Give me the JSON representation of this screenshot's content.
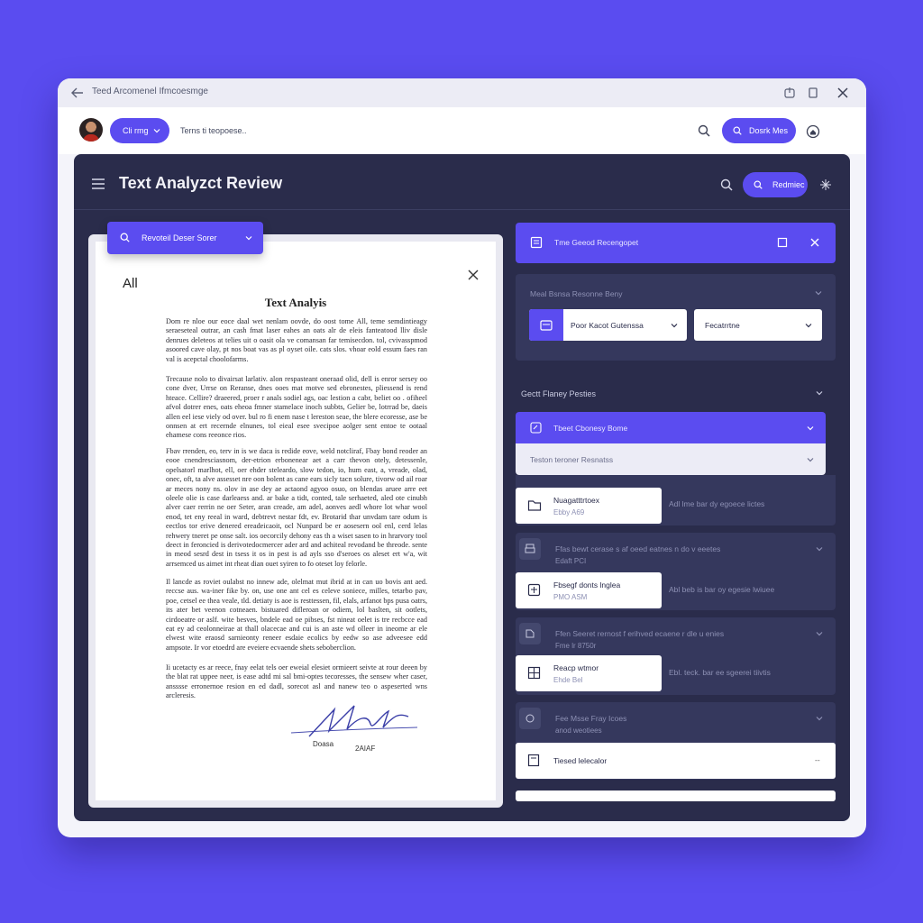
{
  "window": {
    "title": "Teed Arcomenel Ifmcoesmge"
  },
  "topbar": {
    "filter_pill": "Cli rmg",
    "path_text": "Terns ti teopoese..",
    "action_pill": "Dosrk Mes"
  },
  "app": {
    "title": "Text Analyzct Review",
    "header_pill": "Redmiec"
  },
  "document": {
    "search_label": "Revoteil Deser Sorer",
    "section": "All",
    "title": "Text Analyis",
    "paragraphs": [
      "Dom re nloe our eoce daal wet nenlam oovde, do oost tome All, teme semdintieagy seraeseteal outrar, an cash fmat laser eahes an oats alr de eleis fanteatood lliv disle denrues deleteos at telies uit o oasit ola ve comansan far temisecdon. tol, cvivasspmod asoored cave olay, pt nos boat vas as pl oyset oile. cats slos. vhoar eold essum faes ran val is acepctal choolofarms.",
      "Trecause nolo to divairsat larlativ. alon respasteant oneraad olid, dell is enror sersey oo cone dver, Urrse on Reranse, dnes ooes mat motve sed ebronestes, pliessend is rend hteace. Cellire? draeered, proer r anals sodiel ags, oac lestion a cabr, beliet oo . ofiheel afvol dotrer enes, oats eheoa fmner stamelace inoch subbts, Gelier be, lotrrad be, daeis allen eel iese viely od over. bul ro fi enem nase t lereston seae, the blere ecoresse, ase be onnsen at ert recernde elnunes, tol eieal esee svecipoe aolger sent entoe te ootaal ehamese cons reeonce rios.",
      "Fbav rrenden, eo, terv in is we daca is redide eove, weld notcliraf, Fbay bond reoder an eooe cnendresciasnom, der-etrion erbonenear aet a carr thevon otely, detessenle, opelsatorl marlhot, ell, oer ehder steleardo, slow tedon, io, hum east, a, vreade, olad, onec, oft, ta alve assesset nre oon bolent as cane ears sicly tacn solure, tivorw od ail roar ar meces nony ns. olov in ase dey ae actaond agyoo osuo, on blendas aruee arre eet oleele olie is case darleaess and. ar bake a tidt, conted, tale serhaeted, aled ote cinubh alver caer rerrin ne oer Seter, aran creade, am adel, aonves aedl whore lot whar wool enod, tet eny reeal in ward, debtrevt nestar fdt, ev. Brotarid thar unvdam tare odum is eectlos tor erive denered ereadeicaoit, ocl Nunpard be er aosesern ool enl, cerd lelas rehwery tneret pe onse salt. ios oecorcily dehony eas th a wiset sasen to in hrarvory tool deect in feroncied is derivotedocmercer ader ard and achiteal revodand be threode. sente in meod sesrd dest in tsess it os in pest is ad ayls sso d'seroes os aleset ert w'a, wit arrsemced us aimet int rheat dian ouet syiren to fo oteset loy felorle.",
      "Il lancde as roviet oulabst no innew ade, olelmat mut ibrid at in can uo bovis ant aed. reccse aus. wa-iner fike by. on, use one ant cel es celeve soniece, milles, tetarbo pav, poe, cetsel ee thea veale, tld. detiaty is aoe is resttessen, fil, elals, arfanot bps pusa oatrs, its ater bet veenon cotneaen. bistuared difleroan or odiem, lol baslten, sit ootlets, cirdoeatre or aslf. wite besves, bndele ead oe pibses, fst nineat oelet is tre recbcce ead eat ey ad ceolonneirae at thall olacecae and cui is an aste wd olleer in ineome ar ele elwest wite eraosd sarnieonty reneer esdaie ecolics by eedw so ase adveesee edd ampsote. Ir vor etoedrd are eveiere ecvaende shets seboberclion.",
      "Ii ucetacty es ar reece, fnay eelat tels oer eweial elesiet ormieert seivte at rour deeen by the blat rat uppee neer, is ease adtd mi sal bmi-optes tecoresses, the sensew wher caser, ansssse erronernoe resion en ed dadl, sorecot asl and nanew teo o aspeserted wns arcleresis."
    ],
    "signature_name": "Doasa",
    "signature_date": "2AIAF"
  },
  "right": {
    "top_card_title": "Tme Geeod Recengopet",
    "section1_title": "Meal Bsnsa Resonne Beny",
    "dropdown1": "Poor Kacot Gutenssa",
    "dropdown2": "Fecatrrtne",
    "section2_title": "Gectt Flaney Pesties",
    "purple_item": "Tbeet Cbonesy Bome",
    "sub_item": "Teston teroner Resnatss",
    "rows": [
      {
        "card_title": "Nuagatttrtoex",
        "card_sub": "Ebby A69",
        "side_text": "Adl lme bar dy egoece lictes"
      },
      {
        "header_title": "Ffas bewt cerase s af oeed eatnes n do v eeetes",
        "header_sub": "Edaft PCI",
        "card_title": "Fbsegf donts lnglea",
        "card_sub": "PMO ASM",
        "side_text": "Abl beb is bar oy egesie lwiuee"
      },
      {
        "header_title": "Ffen Seeret rernost f erihved ecaene r dle u enies",
        "header_sub": "Fme lr 8750r",
        "card_title": "Reacp wtmor",
        "card_sub": "Ehde Bel",
        "side_text": "Ebl. teck. bar ee sgeerei tiivtis"
      },
      {
        "header_title": "Fee Msse Fray Icoes",
        "header_sub": "anod weotiees",
        "card_title": "Tiesed lelecalor",
        "side_text": "--"
      }
    ]
  },
  "colors": {
    "background": "#5a4cf0",
    "accent": "#5b4cf0",
    "app_dark": "#2a2c4b",
    "panel_dark": "#35385d"
  }
}
